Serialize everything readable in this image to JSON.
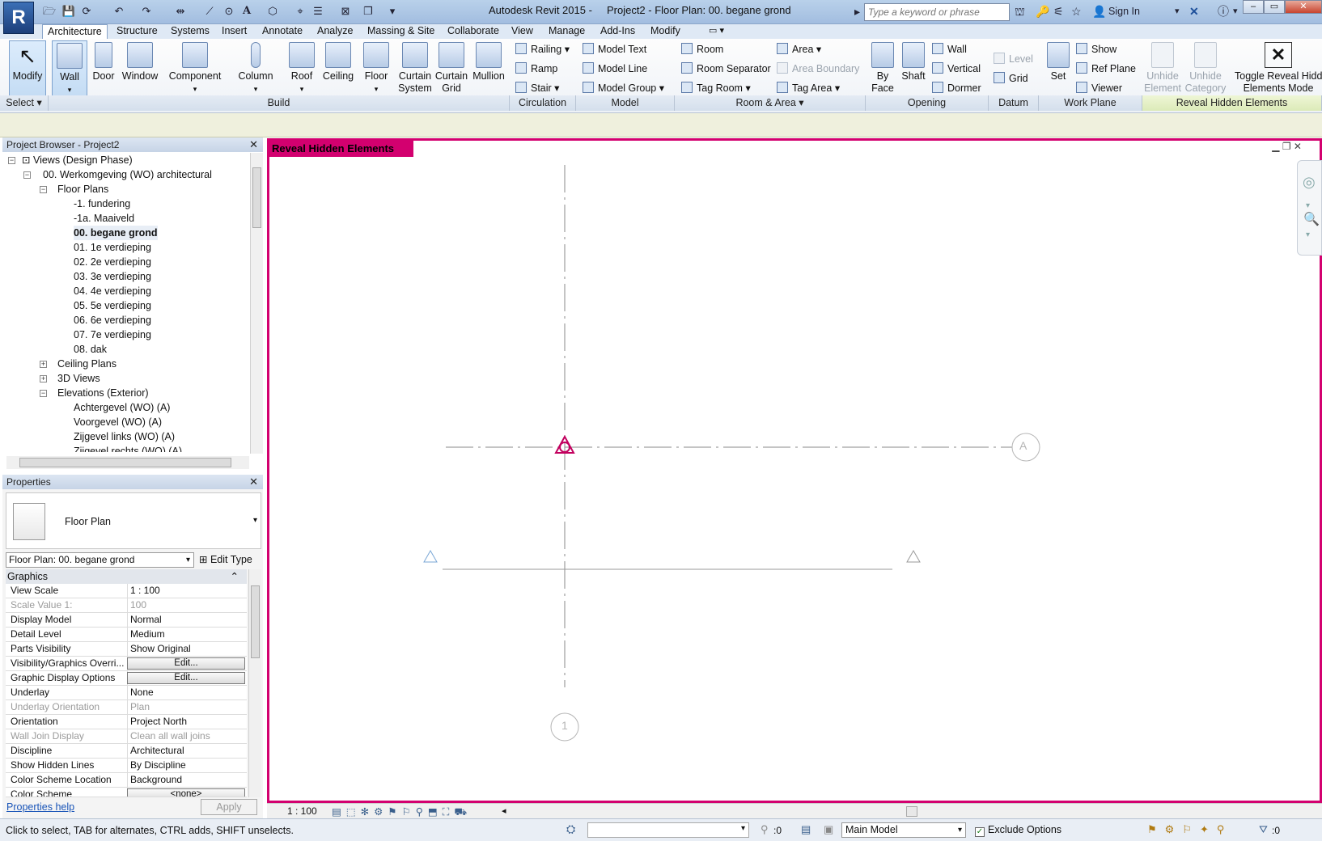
{
  "titlebar": {
    "app_title": "Autodesk Revit 2015 -     Project2 - Floor Plan: 00. begane grond",
    "search_placeholder": "Type a keyword or phrase",
    "sign_in": "Sign In",
    "logo": "R"
  },
  "tabs": [
    "Architecture",
    "Structure",
    "Systems",
    "Insert",
    "Annotate",
    "Analyze",
    "Massing & Site",
    "Collaborate",
    "View",
    "Manage",
    "Add-Ins",
    "Modify"
  ],
  "ribbon": {
    "modify": "Modify",
    "select": "Select",
    "build": {
      "label": "Build",
      "wall": "Wall",
      "door": "Door",
      "window": "Window",
      "component": "Component",
      "column": "Column",
      "roof": "Roof",
      "ceiling": "Ceiling",
      "floor": "Floor",
      "curtain_system": [
        "Curtain",
        "System"
      ],
      "curtain_grid": [
        "Curtain",
        "Grid"
      ],
      "mullion": "Mullion"
    },
    "circulation": {
      "label": "Circulation",
      "railing": "Railing",
      "ramp": "Ramp",
      "stair": "Stair"
    },
    "model": {
      "label": "Model",
      "text": "Model  Text",
      "line": "Model  Line",
      "group": "Model  Group"
    },
    "room_area": {
      "label": "Room & Area",
      "room": "Room",
      "room_separator": "Room  Separator",
      "tag_room": "Tag  Room",
      "area": "Area",
      "area_boundary": "Area  Boundary",
      "tag_area": "Tag  Area"
    },
    "opening": {
      "label": "Opening",
      "by_face": [
        "By",
        "Face"
      ],
      "shaft": "Shaft",
      "wall": "Wall",
      "vertical": "Vertical",
      "dormer": "Dormer"
    },
    "datum": {
      "label": "Datum",
      "level": "Level",
      "grid": "Grid"
    },
    "work_plane": {
      "label": "Work Plane",
      "set": "Set",
      "show": "Show",
      "ref_plane": "Ref  Plane",
      "viewer": "Viewer"
    },
    "reveal": {
      "label": "Reveal Hidden Elements",
      "unhide_element": [
        "Unhide",
        "Element"
      ],
      "unhide_category": [
        "Unhide",
        "Category"
      ],
      "toggle": [
        "Toggle Reveal Hidd",
        "Elements Mode"
      ]
    }
  },
  "project_browser": {
    "title": "Project Browser - Project2",
    "nodes": [
      {
        "label": "Views (Design Phase)"
      },
      {
        "label": "00. Werkomgeving (WO) architectural"
      },
      {
        "label": "Floor Plans"
      },
      {
        "label": "-1. fundering"
      },
      {
        "label": "-1a. Maaiveld"
      },
      {
        "label": "00. begane grond"
      },
      {
        "label": "01. 1e verdieping"
      },
      {
        "label": "02. 2e verdieping"
      },
      {
        "label": "03. 3e verdieping"
      },
      {
        "label": "04. 4e verdieping"
      },
      {
        "label": "05. 5e verdieping"
      },
      {
        "label": "06. 6e verdieping"
      },
      {
        "label": "07. 7e verdieping"
      },
      {
        "label": "08. dak"
      },
      {
        "label": "Ceiling Plans"
      },
      {
        "label": "3D Views"
      },
      {
        "label": "Elevations (Exterior)"
      },
      {
        "label": "Achtergevel (WO) (A)"
      },
      {
        "label": "Voorgevel (WO) (A)"
      },
      {
        "label": "Zijgevel links (WO) (A)"
      },
      {
        "label": "Zijgevel rechts (WO) (A)"
      }
    ]
  },
  "properties": {
    "title": "Properties",
    "type_name": "Floor Plan",
    "view_selector": "Floor Plan: 00. begane grond",
    "edit_type": "Edit Type",
    "group": "Graphics",
    "rows": [
      {
        "key": "View Scale",
        "value": "1 : 100"
      },
      {
        "key": "Scale Value    1:",
        "value": "100"
      },
      {
        "key": "Display Model",
        "value": "Normal"
      },
      {
        "key": "Detail Level",
        "value": "Medium"
      },
      {
        "key": "Parts Visibility",
        "value": "Show Original"
      },
      {
        "key": "Visibility/Graphics Overri...",
        "value": "Edit..."
      },
      {
        "key": "Graphic Display Options",
        "value": "Edit..."
      },
      {
        "key": "Underlay",
        "value": "None"
      },
      {
        "key": "Underlay Orientation",
        "value": "Plan"
      },
      {
        "key": "Orientation",
        "value": "Project North"
      },
      {
        "key": "Wall Join Display",
        "value": "Clean all wall joins"
      },
      {
        "key": "Discipline",
        "value": "Architectural"
      },
      {
        "key": "Show Hidden Lines",
        "value": "By Discipline"
      },
      {
        "key": "Color Scheme Location",
        "value": "Background"
      },
      {
        "key": "Color Scheme",
        "value": "<none>"
      }
    ],
    "help": "Properties help",
    "apply": "Apply"
  },
  "canvas": {
    "mode_label": "Reveal Hidden Elements",
    "grid_a": "A",
    "grid_1": "1",
    "scale": "1 : 100"
  },
  "statusbar": {
    "message": "Click to select, TAB for alternates, CTRL adds, SHIFT unselects.",
    "worksets_count": ":0",
    "model": "Main Model",
    "exclude_options": "Exclude Options",
    "filter_count": ":0"
  },
  "colors": {
    "reveal_accent": "#d3006f",
    "ribbon_bg": "#eef2f7"
  }
}
